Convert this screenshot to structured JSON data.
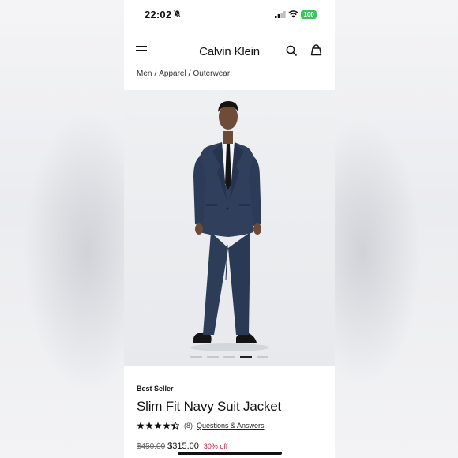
{
  "status_bar": {
    "time": "22:02",
    "battery": "100"
  },
  "header": {
    "logo": "Calvin Klein"
  },
  "breadcrumb": [
    "Men",
    "Apparel",
    "Outerwear"
  ],
  "gallery": {
    "slide_count": 5,
    "active_index": 3
  },
  "product": {
    "badge": "Best Seller",
    "title": "Slim Fit Navy Suit Jacket",
    "rating": 4.5,
    "review_count": "(8)",
    "qa_link": "Questions & Answers",
    "original_price": "$450.00",
    "sale_price": "$315.00",
    "discount": "30% off"
  },
  "colors": {
    "discount": "#c8102e",
    "battery": "#34c759",
    "suit": "#2b3a55"
  }
}
